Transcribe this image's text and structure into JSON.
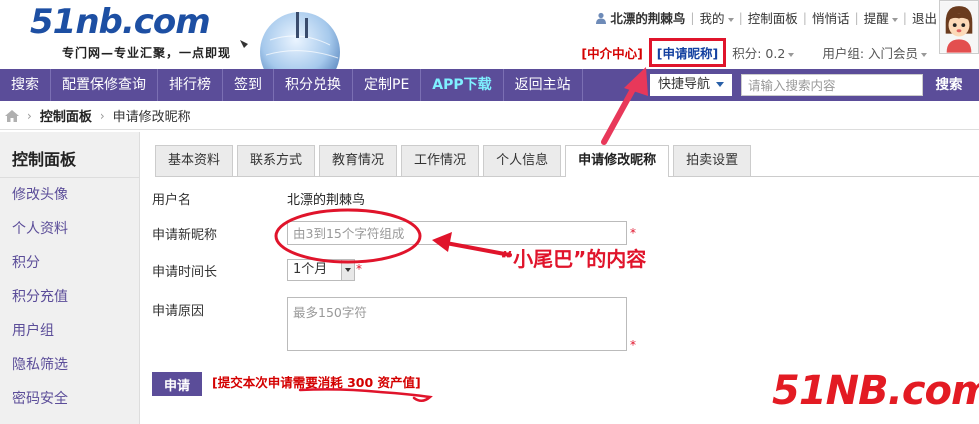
{
  "header": {
    "logo_text": "51nb.com",
    "tagline": "专门网—专业汇聚，一点即现",
    "username": "北漂的荆棘鸟",
    "links": [
      "我的",
      "控制面板",
      "悄悄话",
      "提醒",
      "退出"
    ],
    "agent_center": "[中介中心]",
    "apply_nickname": "[申请昵称]",
    "points": "积分: 0.2",
    "usergroup": "用户组: 入门会员"
  },
  "nav": {
    "items": [
      "搜索",
      "配置保修查询",
      "排行榜",
      "签到",
      "积分兑换",
      "定制PE",
      "APP下载",
      "返回主站"
    ],
    "quick_nav": "快捷导航",
    "search_placeholder": "请输入搜索内容",
    "search_button": "搜索"
  },
  "breadcrumb": {
    "control_panel": "控制面板",
    "current": "申请修改昵称"
  },
  "sidebar": {
    "title": "控制面板",
    "items": [
      "修改头像",
      "个人资料",
      "积分",
      "积分充值",
      "用户组",
      "隐私筛选",
      "密码安全"
    ]
  },
  "tabs": [
    "基本资料",
    "联系方式",
    "教育情况",
    "工作情况",
    "个人信息",
    "申请修改昵称",
    "拍卖设置"
  ],
  "active_tab": "申请修改昵称",
  "form": {
    "username_label": "用户名",
    "username_value": "北漂的荆棘鸟",
    "newnick_label": "申请新昵称",
    "newnick_placeholder": "由3到15个字符组成",
    "duration_label": "申请时间长",
    "duration_value": "1个月",
    "reason_label": "申请原因",
    "reason_placeholder": "最多150字符",
    "required_mark": "*",
    "submit": "申请",
    "cost_note": "[提交本次申请需要消耗 300 资产值]"
  },
  "annotation": {
    "text": "“小尾巴”的内容",
    "color": "#e0142b"
  },
  "watermark": "51NB.com",
  "colors": {
    "nav_bg": "#5b4d99",
    "accent_red": "#e0142b",
    "link_purple": "#5b4d99"
  }
}
